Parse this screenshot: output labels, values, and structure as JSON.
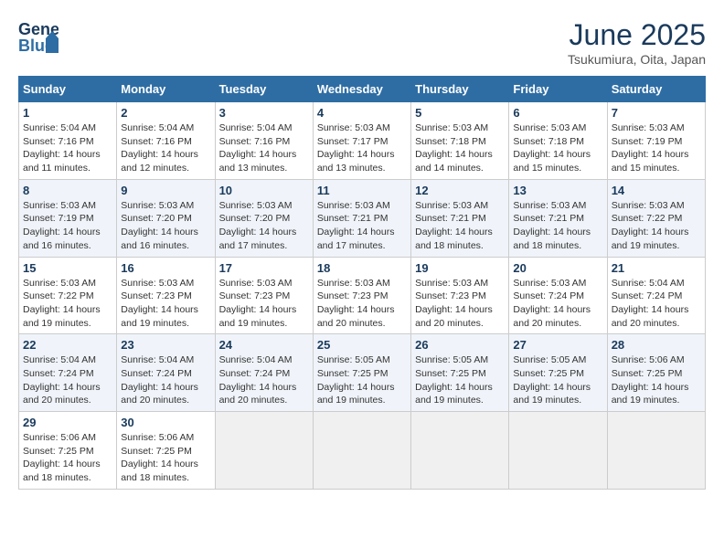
{
  "header": {
    "logo_general": "General",
    "logo_blue": "Blue",
    "month_year": "June 2025",
    "location": "Tsukumiura, Oita, Japan"
  },
  "calendar": {
    "days_of_week": [
      "Sunday",
      "Monday",
      "Tuesday",
      "Wednesday",
      "Thursday",
      "Friday",
      "Saturday"
    ],
    "weeks": [
      [
        null,
        {
          "day": 2,
          "sunrise": "Sunrise: 5:04 AM",
          "sunset": "Sunset: 7:16 PM",
          "daylight": "Daylight: 14 hours and 12 minutes."
        },
        {
          "day": 3,
          "sunrise": "Sunrise: 5:04 AM",
          "sunset": "Sunset: 7:16 PM",
          "daylight": "Daylight: 14 hours and 13 minutes."
        },
        {
          "day": 4,
          "sunrise": "Sunrise: 5:03 AM",
          "sunset": "Sunset: 7:17 PM",
          "daylight": "Daylight: 14 hours and 13 minutes."
        },
        {
          "day": 5,
          "sunrise": "Sunrise: 5:03 AM",
          "sunset": "Sunset: 7:18 PM",
          "daylight": "Daylight: 14 hours and 14 minutes."
        },
        {
          "day": 6,
          "sunrise": "Sunrise: 5:03 AM",
          "sunset": "Sunset: 7:18 PM",
          "daylight": "Daylight: 14 hours and 15 minutes."
        },
        {
          "day": 7,
          "sunrise": "Sunrise: 5:03 AM",
          "sunset": "Sunset: 7:19 PM",
          "daylight": "Daylight: 14 hours and 15 minutes."
        }
      ],
      [
        {
          "day": 1,
          "sunrise": "Sunrise: 5:04 AM",
          "sunset": "Sunset: 7:16 PM",
          "daylight": "Daylight: 14 hours and 11 minutes."
        },
        {
          "day": 9,
          "sunrise": "Sunrise: 5:03 AM",
          "sunset": "Sunset: 7:20 PM",
          "daylight": "Daylight: 14 hours and 16 minutes."
        },
        {
          "day": 10,
          "sunrise": "Sunrise: 5:03 AM",
          "sunset": "Sunset: 7:20 PM",
          "daylight": "Daylight: 14 hours and 17 minutes."
        },
        {
          "day": 11,
          "sunrise": "Sunrise: 5:03 AM",
          "sunset": "Sunset: 7:21 PM",
          "daylight": "Daylight: 14 hours and 17 minutes."
        },
        {
          "day": 12,
          "sunrise": "Sunrise: 5:03 AM",
          "sunset": "Sunset: 7:21 PM",
          "daylight": "Daylight: 14 hours and 18 minutes."
        },
        {
          "day": 13,
          "sunrise": "Sunrise: 5:03 AM",
          "sunset": "Sunset: 7:21 PM",
          "daylight": "Daylight: 14 hours and 18 minutes."
        },
        {
          "day": 14,
          "sunrise": "Sunrise: 5:03 AM",
          "sunset": "Sunset: 7:22 PM",
          "daylight": "Daylight: 14 hours and 19 minutes."
        }
      ],
      [
        {
          "day": 8,
          "sunrise": "Sunrise: 5:03 AM",
          "sunset": "Sunset: 7:19 PM",
          "daylight": "Daylight: 14 hours and 16 minutes."
        },
        {
          "day": 16,
          "sunrise": "Sunrise: 5:03 AM",
          "sunset": "Sunset: 7:23 PM",
          "daylight": "Daylight: 14 hours and 19 minutes."
        },
        {
          "day": 17,
          "sunrise": "Sunrise: 5:03 AM",
          "sunset": "Sunset: 7:23 PM",
          "daylight": "Daylight: 14 hours and 19 minutes."
        },
        {
          "day": 18,
          "sunrise": "Sunrise: 5:03 AM",
          "sunset": "Sunset: 7:23 PM",
          "daylight": "Daylight: 14 hours and 20 minutes."
        },
        {
          "day": 19,
          "sunrise": "Sunrise: 5:03 AM",
          "sunset": "Sunset: 7:23 PM",
          "daylight": "Daylight: 14 hours and 20 minutes."
        },
        {
          "day": 20,
          "sunrise": "Sunrise: 5:03 AM",
          "sunset": "Sunset: 7:24 PM",
          "daylight": "Daylight: 14 hours and 20 minutes."
        },
        {
          "day": 21,
          "sunrise": "Sunrise: 5:04 AM",
          "sunset": "Sunset: 7:24 PM",
          "daylight": "Daylight: 14 hours and 20 minutes."
        }
      ],
      [
        {
          "day": 15,
          "sunrise": "Sunrise: 5:03 AM",
          "sunset": "Sunset: 7:22 PM",
          "daylight": "Daylight: 14 hours and 19 minutes."
        },
        {
          "day": 23,
          "sunrise": "Sunrise: 5:04 AM",
          "sunset": "Sunset: 7:24 PM",
          "daylight": "Daylight: 14 hours and 20 minutes."
        },
        {
          "day": 24,
          "sunrise": "Sunrise: 5:04 AM",
          "sunset": "Sunset: 7:24 PM",
          "daylight": "Daylight: 14 hours and 20 minutes."
        },
        {
          "day": 25,
          "sunrise": "Sunrise: 5:05 AM",
          "sunset": "Sunset: 7:25 PM",
          "daylight": "Daylight: 14 hours and 19 minutes."
        },
        {
          "day": 26,
          "sunrise": "Sunrise: 5:05 AM",
          "sunset": "Sunset: 7:25 PM",
          "daylight": "Daylight: 14 hours and 19 minutes."
        },
        {
          "day": 27,
          "sunrise": "Sunrise: 5:05 AM",
          "sunset": "Sunset: 7:25 PM",
          "daylight": "Daylight: 14 hours and 19 minutes."
        },
        {
          "day": 28,
          "sunrise": "Sunrise: 5:06 AM",
          "sunset": "Sunset: 7:25 PM",
          "daylight": "Daylight: 14 hours and 19 minutes."
        }
      ],
      [
        {
          "day": 22,
          "sunrise": "Sunrise: 5:04 AM",
          "sunset": "Sunset: 7:24 PM",
          "daylight": "Daylight: 14 hours and 20 minutes."
        },
        {
          "day": 30,
          "sunrise": "Sunrise: 5:06 AM",
          "sunset": "Sunset: 7:25 PM",
          "daylight": "Daylight: 14 hours and 18 minutes."
        },
        null,
        null,
        null,
        null,
        null
      ],
      [
        {
          "day": 29,
          "sunrise": "Sunrise: 5:06 AM",
          "sunset": "Sunset: 7:25 PM",
          "daylight": "Daylight: 14 hours and 18 minutes."
        },
        null,
        null,
        null,
        null,
        null,
        null
      ]
    ]
  }
}
